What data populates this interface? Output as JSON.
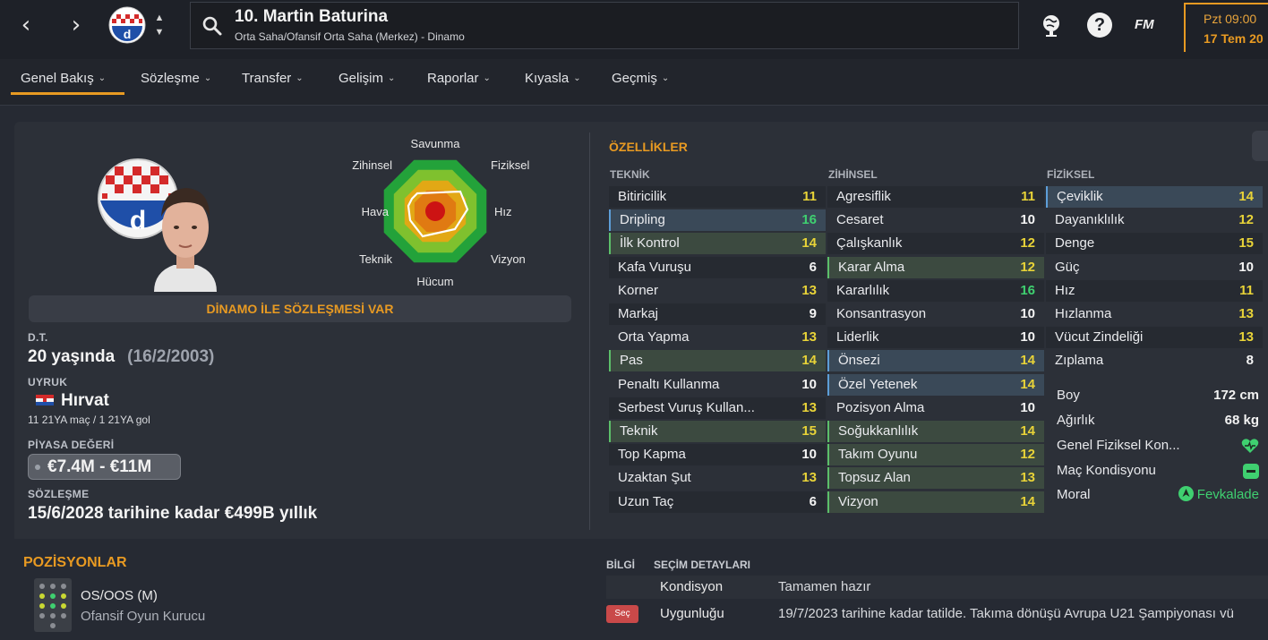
{
  "colors": {
    "accent": "#e89a22",
    "stat_yellow": "#e8d338",
    "stat_green": "#3fd070",
    "stat_white": "#f4f4f4",
    "good": "#3fd070"
  },
  "header": {
    "player_title": "10. Martin Baturina",
    "player_subtitle": "Orta Saha/Ofansif Orta Saha (Merkez) - Dinamo",
    "icons": [
      "back-icon",
      "forward-icon",
      "search-icon",
      "globe-icon",
      "help-icon",
      "fm-logo"
    ],
    "help_glyph": "?",
    "fm_label": "FM",
    "date_line1": "Pzt 09:00",
    "date_line2": "17 Tem 20"
  },
  "tabs": [
    {
      "label": "Genel Bakış"
    },
    {
      "label": "Sözleşme"
    },
    {
      "label": "Transfer"
    },
    {
      "label": "Gelişim"
    },
    {
      "label": "Raporlar"
    },
    {
      "label": "Kıyasla"
    },
    {
      "label": "Geçmiş"
    }
  ],
  "radar": {
    "labels": [
      "Savunma",
      "Fiziksel",
      "Hız",
      "Vizyon",
      "Hücum",
      "Teknik",
      "Hava",
      "Zihinsel"
    ]
  },
  "overview": {
    "contract_banner": "DİNAMO İLE SÖZLEŞMESİ VAR",
    "dob_label": "D.T.",
    "age": "20 yaşında",
    "dob": "(16/2/2003)",
    "nationality_label": "UYRUK",
    "nationality": "Hırvat",
    "caps": "11 21YA maç / 1 21YA gol",
    "market_label": "PİYASA DEĞERİ",
    "market_value": "€7.4M - €11M",
    "contract_label": "SÖZLEŞME",
    "contract": "15/6/2028 tarihine kadar €499B yıllık"
  },
  "attributes": {
    "title": "ÖZELLİKLER",
    "technical": {
      "header": "TEKNİK",
      "rows": [
        {
          "name": "Bitiricilik",
          "value": "11",
          "style": "dark",
          "color": "yellow"
        },
        {
          "name": "Dripling",
          "value": "16",
          "style": "blue",
          "color": "green"
        },
        {
          "name": "İlk Kontrol",
          "value": "14",
          "style": "green",
          "color": "yellow"
        },
        {
          "name": "Kafa Vuruşu",
          "value": "6",
          "style": "dark",
          "color": "white"
        },
        {
          "name": "Korner",
          "value": "13",
          "style": "plain",
          "color": "yellow"
        },
        {
          "name": "Markaj",
          "value": "9",
          "style": "dark",
          "color": "white"
        },
        {
          "name": "Orta Yapma",
          "value": "13",
          "style": "plain",
          "color": "yellow"
        },
        {
          "name": "Pas",
          "value": "14",
          "style": "green",
          "color": "yellow"
        },
        {
          "name": "Penaltı Kullanma",
          "value": "10",
          "style": "plain",
          "color": "white"
        },
        {
          "name": "Serbest Vuruş Kullan...",
          "value": "13",
          "style": "dark",
          "color": "yellow"
        },
        {
          "name": "Teknik",
          "value": "15",
          "style": "green",
          "color": "yellow"
        },
        {
          "name": "Top Kapma",
          "value": "10",
          "style": "dark",
          "color": "white"
        },
        {
          "name": "Uzaktan Şut",
          "value": "13",
          "style": "plain",
          "color": "yellow"
        },
        {
          "name": "Uzun Taç",
          "value": "6",
          "style": "dark",
          "color": "white"
        }
      ]
    },
    "mental": {
      "header": "ZİHİNSEL",
      "rows": [
        {
          "name": "Agresiflik",
          "value": "11",
          "style": "dark",
          "color": "yellow"
        },
        {
          "name": "Cesaret",
          "value": "10",
          "style": "plain",
          "color": "white"
        },
        {
          "name": "Çalışkanlık",
          "value": "12",
          "style": "dark",
          "color": "yellow"
        },
        {
          "name": "Karar Alma",
          "value": "12",
          "style": "green",
          "color": "yellow"
        },
        {
          "name": "Kararlılık",
          "value": "16",
          "style": "dark",
          "color": "green"
        },
        {
          "name": "Konsantrasyon",
          "value": "10",
          "style": "plain",
          "color": "white"
        },
        {
          "name": "Liderlik",
          "value": "10",
          "style": "dark",
          "color": "white"
        },
        {
          "name": "Önsezi",
          "value": "14",
          "style": "blue",
          "color": "yellow"
        },
        {
          "name": "Özel Yetenek",
          "value": "14",
          "style": "blue",
          "color": "yellow"
        },
        {
          "name": "Pozisyon Alma",
          "value": "10",
          "style": "plain",
          "color": "white"
        },
        {
          "name": "Soğukkanlılık",
          "value": "14",
          "style": "green",
          "color": "yellow"
        },
        {
          "name": "Takım Oyunu",
          "value": "12",
          "style": "green",
          "color": "yellow"
        },
        {
          "name": "Topsuz Alan",
          "value": "13",
          "style": "green",
          "color": "yellow"
        },
        {
          "name": "Vizyon",
          "value": "14",
          "style": "green",
          "color": "yellow"
        }
      ]
    },
    "physical": {
      "header": "FİZİKSEL",
      "rows": [
        {
          "name": "Çeviklik",
          "value": "14",
          "style": "blue",
          "color": "yellow"
        },
        {
          "name": "Dayanıklılık",
          "value": "12",
          "style": "plain",
          "color": "yellow"
        },
        {
          "name": "Denge",
          "value": "15",
          "style": "dark",
          "color": "yellow"
        },
        {
          "name": "Güç",
          "value": "10",
          "style": "plain",
          "color": "white"
        },
        {
          "name": "Hız",
          "value": "11",
          "style": "dark",
          "color": "yellow"
        },
        {
          "name": "Hızlanma",
          "value": "13",
          "style": "plain",
          "color": "yellow"
        },
        {
          "name": "Vücut Zindeliği",
          "value": "13",
          "style": "dark",
          "color": "yellow"
        },
        {
          "name": "Zıplama",
          "value": "8",
          "style": "plain",
          "color": "white"
        }
      ],
      "height_label": "Boy",
      "height": "172 cm",
      "weight_label": "Ağırlık",
      "weight": "68 kg",
      "fitness_label": "Genel Fiziksel Kon...",
      "match_fitness_label": "Maç Kondisyonu",
      "morale_label": "Moral",
      "morale": "Fevkalade"
    }
  },
  "positions": {
    "title": "POZİSYONLAR",
    "primary": "OS/OOS (M)",
    "role": "Ofansif Oyun Kurucu"
  },
  "info": {
    "tab_info": "BİLGİ",
    "tab_selection": "SEÇİM DETAYLARI",
    "rows": [
      {
        "key": "Kondisyon",
        "value": "Tamamen hazır"
      },
      {
        "key": "Uygunluğu",
        "value": "19/7/2023 tarihine kadar tatilde. Takıma dönüşü Avrupa U21 Şampiyonası vü"
      }
    ],
    "select_button": "Seç"
  }
}
